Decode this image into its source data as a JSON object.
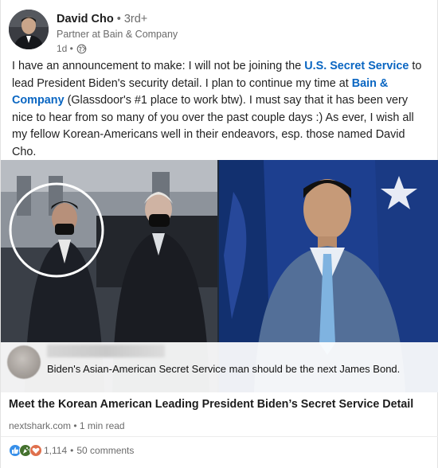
{
  "author": {
    "name": "David Cho",
    "degree": "• 3rd+",
    "headline": "Partner at Bain & Company",
    "time": "1d •"
  },
  "post": {
    "p1": "I have an announcement to make: I will not be joining the ",
    "link1": "U.S. Secret Service",
    "p2": " to lead President Biden's security detail. I plan to continue my time at ",
    "link2": "Bain & Company",
    "p3": " (Glassdoor's #1 place to work btw). I must say that it has been very nice to hear from so many of you over the past couple days :) As ever, I wish all my fellow Korean-Americans well in their endeavors, esp. those named David Cho."
  },
  "image_caption": "Biden's Asian-American Secret Service man should be the next James Bond.",
  "article": {
    "title": "Meet the Korean American Leading President Biden’s Secret Service Detail",
    "source": "nextshark.com • 1 min read"
  },
  "social": {
    "reactions": "1,114",
    "comments": "50 comments",
    "separator": "•"
  },
  "colors": {
    "link": "#0a66c2",
    "like": "#378fe9",
    "celebrate": "#44712e",
    "love": "#df704d"
  }
}
